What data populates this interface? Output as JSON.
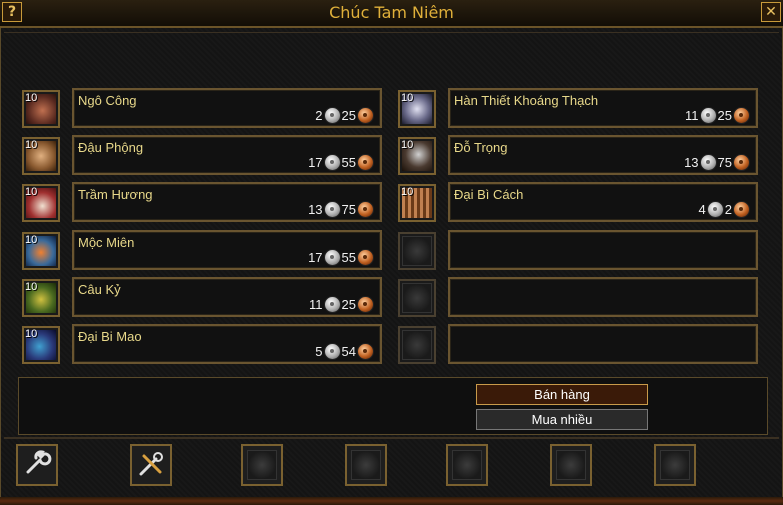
{
  "window": {
    "title": "Chúc Tam Niêm",
    "help_glyph": "?",
    "close_glyph": "✕"
  },
  "shop_items": [
    {
      "qty": "10",
      "name": "Ngô Công",
      "silver": "2",
      "copper": "25",
      "icon": "centipede-icon",
      "color": "#6a4a3a"
    },
    {
      "qty": "10",
      "name": "Đậu Phộng",
      "silver": "17",
      "copper": "55",
      "icon": "peanut-icon",
      "color": "#a08050"
    },
    {
      "qty": "10",
      "name": "Trầm Hương",
      "silver": "13",
      "copper": "75",
      "icon": "agarwood-icon",
      "color": "#8a3030"
    },
    {
      "qty": "10",
      "name": "Mộc Miên",
      "silver": "17",
      "copper": "55",
      "icon": "kapok-flower-icon",
      "color": "#3a5a8a"
    },
    {
      "qty": "10",
      "name": "Câu Kỷ",
      "silver": "11",
      "copper": "25",
      "icon": "goji-icon",
      "color": "#5a6a2a"
    },
    {
      "qty": "10",
      "name": "Đại Bi Mao",
      "silver": "5",
      "copper": "54",
      "icon": "feather-icon",
      "color": "#2a3a6a"
    },
    {
      "qty": "10",
      "name": "Hàn Thiết Khoáng Thạch",
      "silver": "11",
      "copper": "25",
      "icon": "iron-ore-icon",
      "color": "#5a5a7a"
    },
    {
      "qty": "10",
      "name": "Đỗ Trọng",
      "silver": "13",
      "copper": "75",
      "icon": "bark-icon",
      "color": "#4a3a30"
    },
    {
      "qty": "10",
      "name": "Đại Bì Cách",
      "silver": "4",
      "copper": "2",
      "icon": "hide-icon",
      "color": "#8a5a30"
    }
  ],
  "buttons": {
    "sell": "Bán hàng",
    "buy_bulk": "Mua nhiều"
  },
  "toolbar": {
    "tools": [
      {
        "name": "repair-tool-icon"
      },
      {
        "name": "repair-all-icon"
      }
    ],
    "empty_slots": 5
  }
}
